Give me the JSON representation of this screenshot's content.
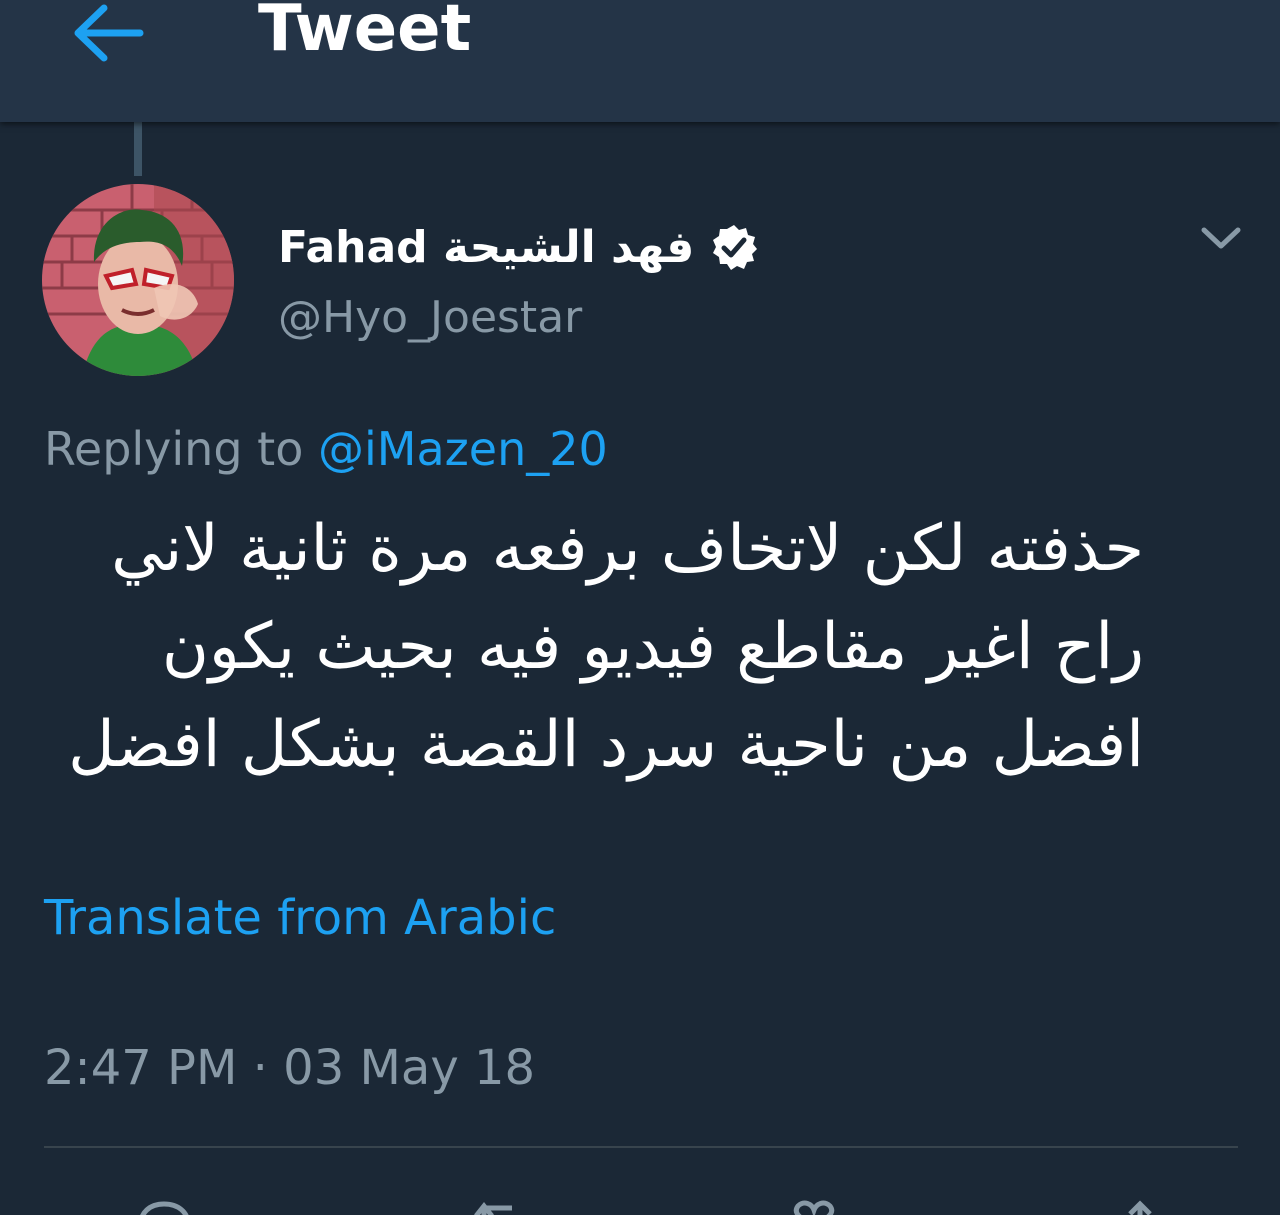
{
  "header": {
    "title": "Tweet",
    "back_icon": "arrow-left-icon"
  },
  "tweet": {
    "author": {
      "display_name": "Fahad فهد الشيحة",
      "handle": "@Hyo_Joestar",
      "verified": true
    },
    "replying_prefix": "Replying to",
    "replying_to": "@iMazen_20",
    "text_lines": [
      "حذفته لكن لاتخاف برفعه مرة ثانية لاني",
      "راح اغير مقاطع فيديو فيه بحيث يكون",
      "افضل من ناحية سرد القصة بشكل افضل"
    ],
    "translate_label": "Translate from Arabic",
    "timestamp": "2:47 PM · 03 May 18"
  },
  "actions": [
    {
      "icon": "reply-icon"
    },
    {
      "icon": "retweet-icon"
    },
    {
      "icon": "like-icon"
    },
    {
      "icon": "share-icon"
    }
  ],
  "colors": {
    "background": "#1b2836",
    "header": "#243447",
    "accent": "#1da1f2",
    "secondary_text": "#8899a6"
  }
}
